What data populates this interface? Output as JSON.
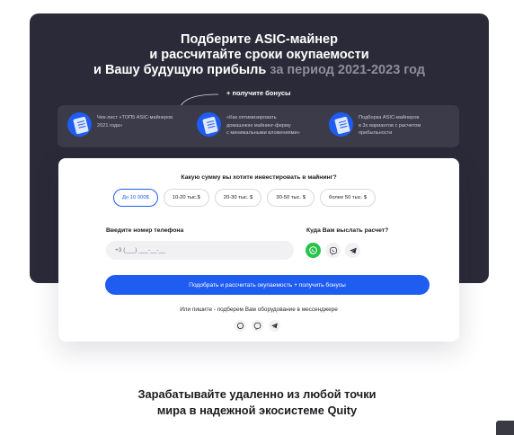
{
  "hero": {
    "title_line1": "Подберите ASIC-майнер",
    "title_line2": "и рассчитайте сроки окупаемости",
    "title_line3_main": "и Вашу будущую прибыль",
    "title_line3_muted": " за период 2021-2023 год",
    "bonus_label": "+ получите бонусы",
    "bonuses": [
      {
        "text": "Чек-лист «ТОП5 ASIC-майнеров\n2021 года»",
        "icon": "document-icon"
      },
      {
        "text": "«Как оптимизировать\nдомашнюю майнинг-ферму\nс минимальными вложениями»",
        "icon": "document-icon"
      },
      {
        "text": "Подборка ASIC-майнеров\nв 3х вариантов с расчетом\nприбыльности",
        "icon": "document-icon"
      }
    ]
  },
  "form": {
    "question": "Какую сумму вы хотите инвестировать в майнинг?",
    "amounts": [
      {
        "label": "До 10 000$",
        "selected": true
      },
      {
        "label": "10-20 тыс.$",
        "selected": false
      },
      {
        "label": "20-30 тыс. $",
        "selected": false
      },
      {
        "label": "30-50 тыс. $",
        "selected": false
      },
      {
        "label": "более 50 тыс. $",
        "selected": false
      }
    ],
    "phone_label": "Введите номер телефона",
    "phone_placeholder": "+3 (___) ___-__-__",
    "messenger_label": "Куда Вам выслать расчет?",
    "messengers": [
      "whatsapp-icon",
      "viber-icon",
      "telegram-icon"
    ],
    "selected_messenger": "whatsapp-icon",
    "submit_label": "Подобрать и рассчитать окупаемость + получить бонусы",
    "alt_contact_text": "Или пишите - подберем Вам оборудование в мессенджере"
  },
  "footer": {
    "tagline_line1": "Зарабатывайте удаленно из любой точки",
    "tagline_line2": "мира в надежной экосистеме Quity"
  },
  "colors": {
    "accent": "#1f5cf0",
    "hero_bg": "#2b2a38",
    "whatsapp": "#27c44b"
  }
}
